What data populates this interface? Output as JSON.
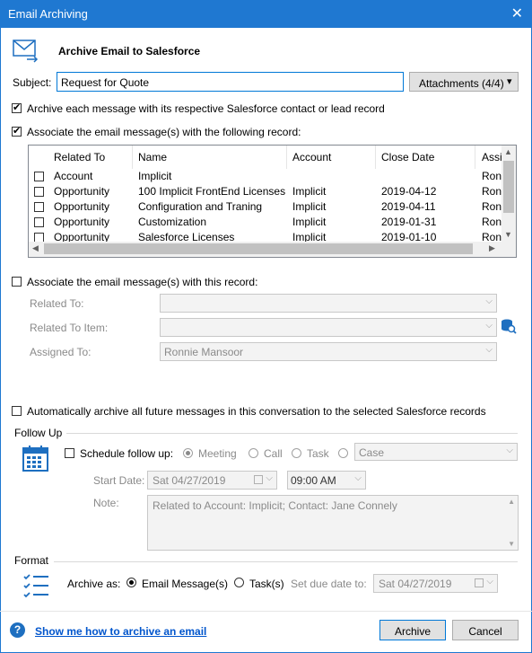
{
  "window": {
    "title": "Email Archiving",
    "close_glyph": "✕"
  },
  "header": {
    "title": "Archive Email to Salesforce",
    "icon": "email-archive-icon"
  },
  "subject": {
    "label": "Subject:",
    "value": "Request for Quote"
  },
  "attachments_button": {
    "label": "Attachments (4/4)",
    "arrow": "▾"
  },
  "archive_each": {
    "label": "Archive each message with its respective Salesforce contact or lead record",
    "checked": true
  },
  "associate_following": {
    "label": "Associate the email message(s) with the following record:",
    "checked": true
  },
  "records_table": {
    "columns": [
      "Related To",
      "Name",
      "Account",
      "Close Date",
      "Assig"
    ],
    "rows": [
      {
        "related_to": "Account",
        "name": "Implicit",
        "account": "",
        "close_date": "",
        "assigned": "Ronni"
      },
      {
        "related_to": "Opportunity",
        "name": "100 Implicit FrontEnd Licenses",
        "account": "Implicit",
        "close_date": "2019-04-12",
        "assigned": "Ronni"
      },
      {
        "related_to": "Opportunity",
        "name": "Configuration and Traning",
        "account": "Implicit",
        "close_date": "2019-04-11",
        "assigned": "Ronni"
      },
      {
        "related_to": "Opportunity",
        "name": "Customization",
        "account": "Implicit",
        "close_date": "2019-01-31",
        "assigned": "Ronni"
      },
      {
        "related_to": "Opportunity",
        "name": "Salesforce Licenses",
        "account": "Implicit",
        "close_date": "2019-01-10",
        "assigned": "Ronni"
      }
    ]
  },
  "associate_this": {
    "label": "Associate the email message(s) with this record:",
    "checked": false
  },
  "related_to": {
    "label": "Related To:",
    "value": ""
  },
  "related_to_item": {
    "label": "Related To Item:",
    "value": ""
  },
  "assigned_to": {
    "label": "Assigned To:",
    "value": "Ronnie Mansoor"
  },
  "auto_archive": {
    "label": "Automatically archive all future messages in this conversation to the selected Salesforce records",
    "checked": false
  },
  "follow_up": {
    "section_label": "Follow Up",
    "schedule_label": "Schedule follow up:",
    "options": [
      "Meeting",
      "Call",
      "Task"
    ],
    "selected": "Meeting",
    "case_value": "Case",
    "start_date_label": "Start Date:",
    "start_date": "Sat  04/27/2019",
    "time": "09:00 AM",
    "note_label": "Note:",
    "note": "Related to Account: Implicit; Contact: Jane Connely"
  },
  "format": {
    "section_label": "Format",
    "archive_as_label": "Archive as:",
    "options": [
      "Email Message(s)",
      "Task(s)"
    ],
    "selected": "Email Message(s)",
    "due_date_label": "Set due date to:",
    "due_date": "Sat  04/27/2019"
  },
  "footer": {
    "help_link": "Show me how to archive an email",
    "archive_button": "Archive",
    "cancel_button": "Cancel"
  },
  "colors": {
    "titlebar": "#1f78d1",
    "link": "#0055cc",
    "icon_blue": "#1e6fc0"
  }
}
